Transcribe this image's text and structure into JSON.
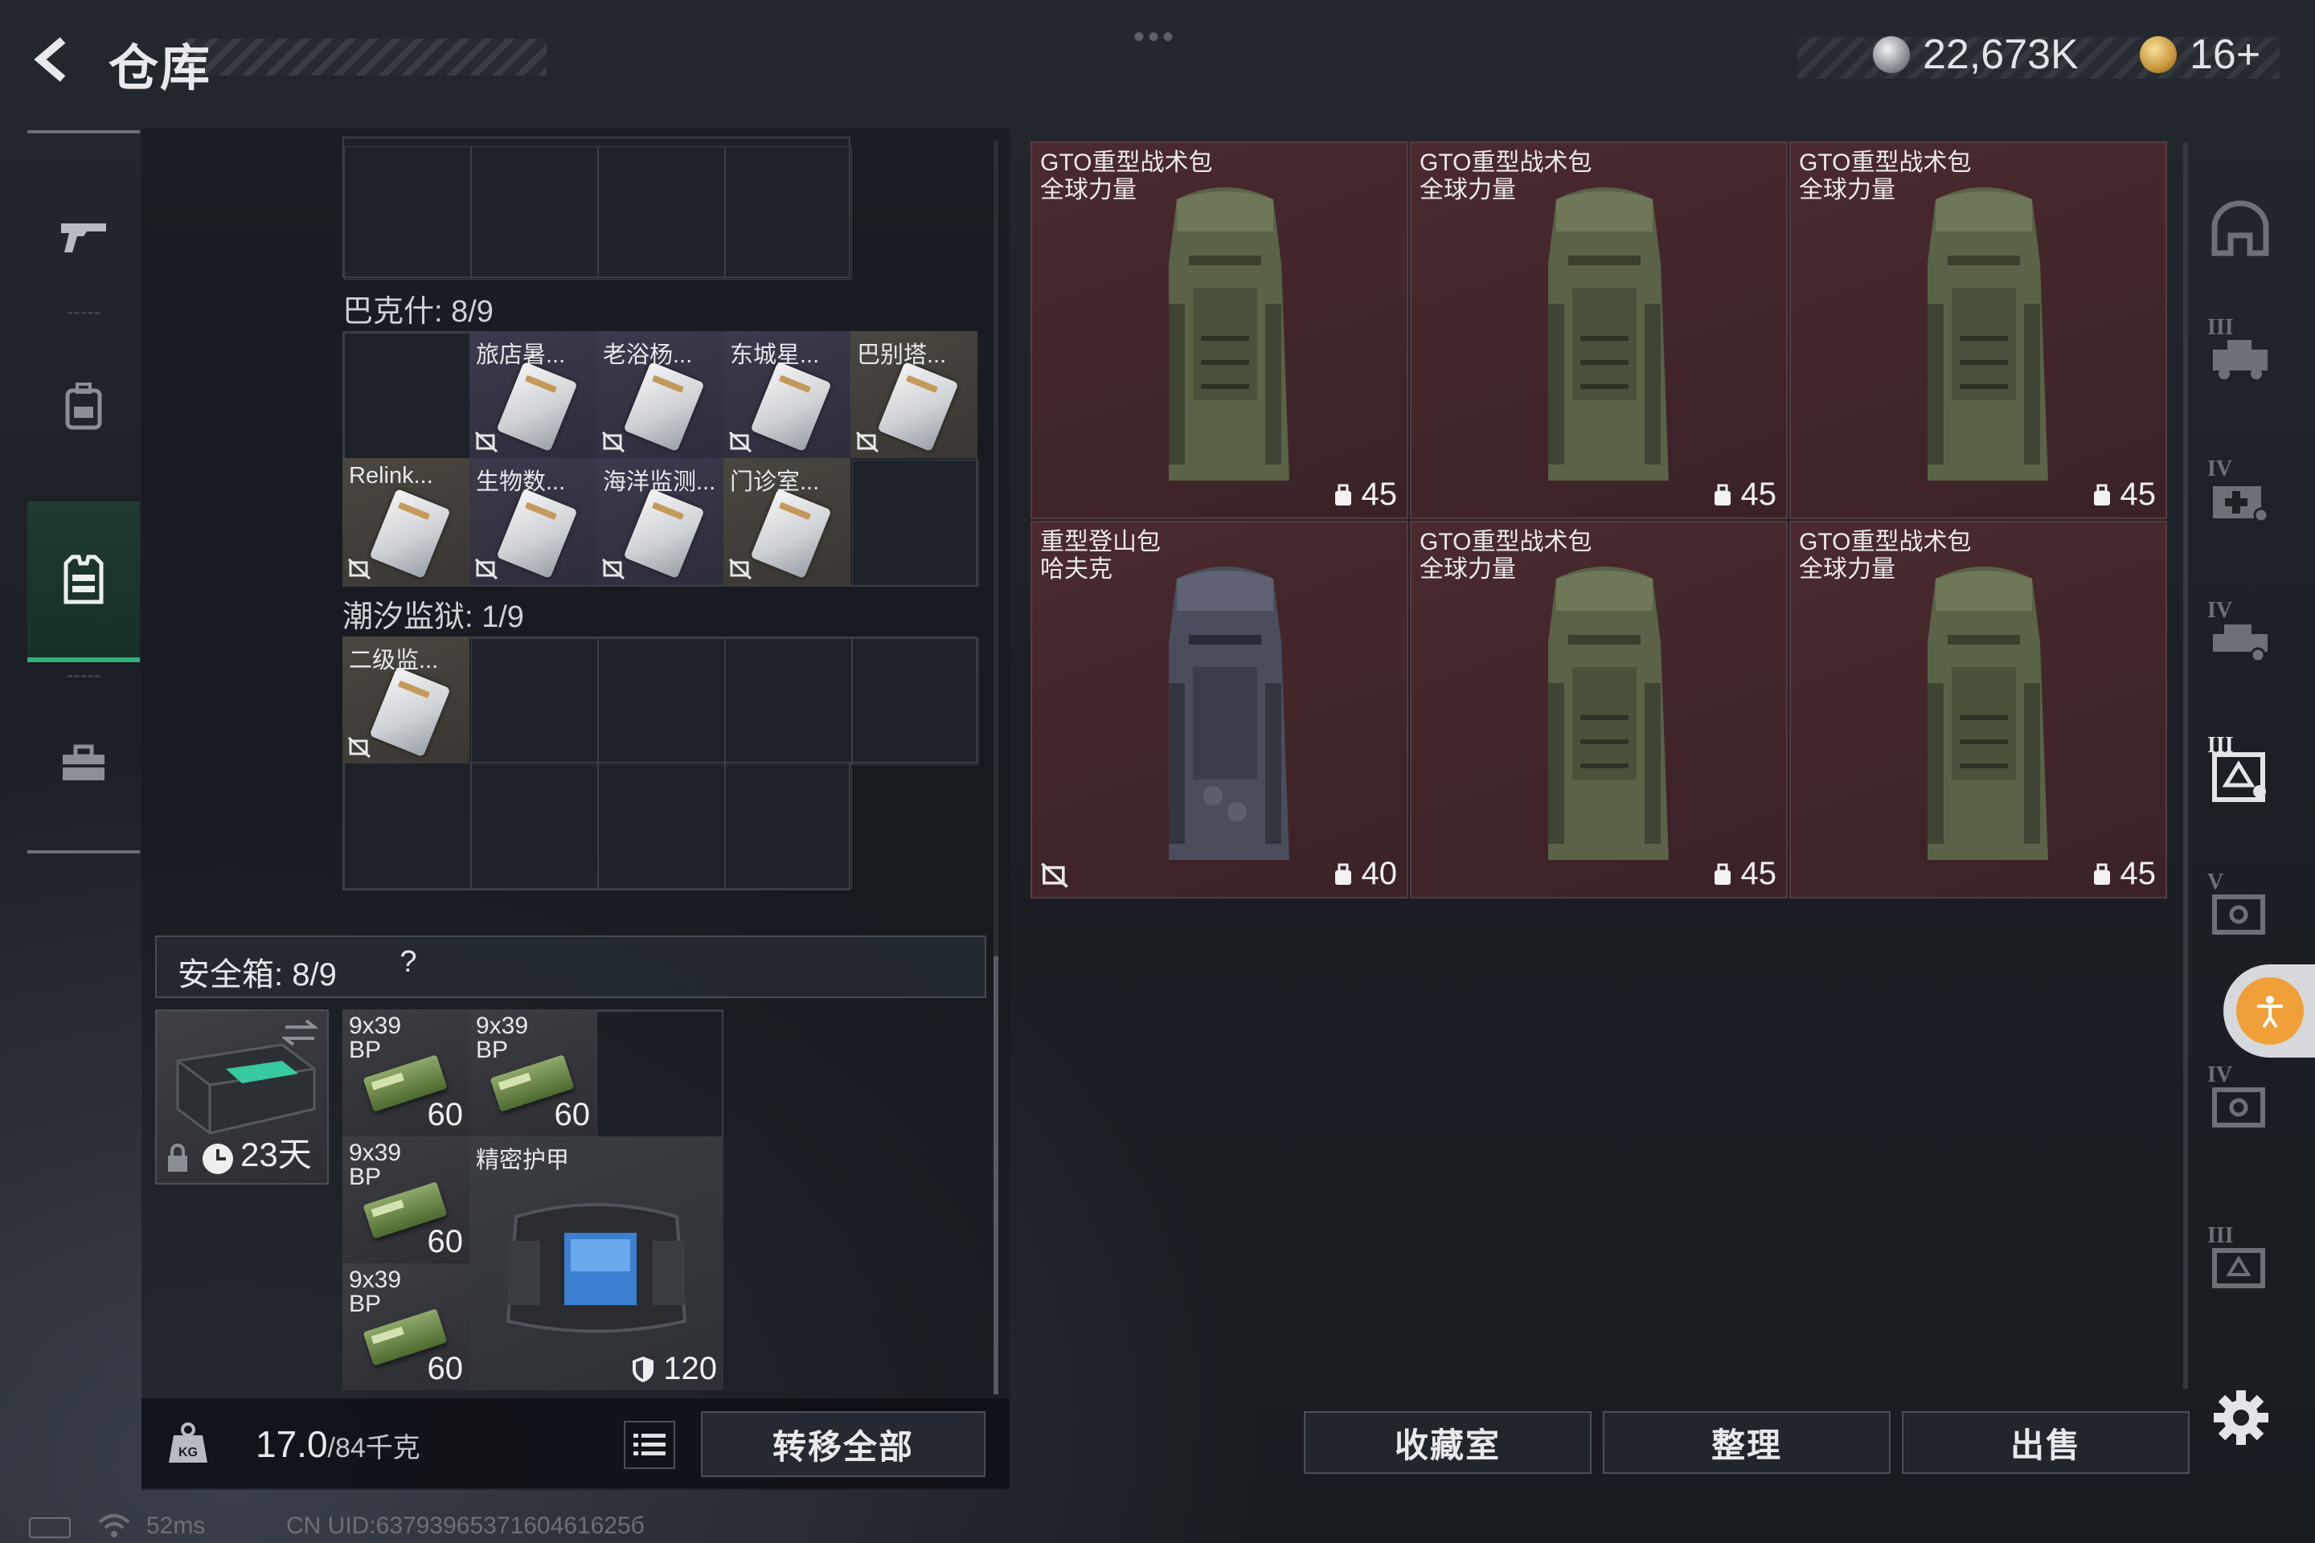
{
  "header": {
    "title": "仓库",
    "currency_silver": "22,673K",
    "currency_gold": "16+"
  },
  "left_nav": [
    "gun-icon",
    "backpack-icon",
    "vest-icon",
    "toolbox-icon"
  ],
  "sections": {
    "bakshi": {
      "label": "巴克什: 8/9",
      "items": [
        {
          "label": "旅店暑..."
        },
        {
          "label": "老浴杨..."
        },
        {
          "label": "东城星..."
        },
        {
          "label": "巴别塔..."
        },
        {
          "label": "Relink..."
        },
        {
          "label": "生物数..."
        },
        {
          "label": "海洋监测..."
        },
        {
          "label": "门诊室..."
        }
      ]
    },
    "tidal_prison": {
      "label": "潮汐监狱: 1/9",
      "items": [
        {
          "label": "二级监..."
        }
      ]
    }
  },
  "safe_box": {
    "title": "安全箱: 8/9",
    "help": "?",
    "duration": "23天",
    "ammo": [
      {
        "label_line1": "9x39",
        "label_line2": "BP",
        "count": "60"
      },
      {
        "label_line1": "9x39",
        "label_line2": "BP",
        "count": "60"
      },
      {
        "label_line1": "9x39",
        "label_line2": "BP",
        "count": "60"
      },
      {
        "label_line1": "9x39",
        "label_line2": "BP",
        "count": "60"
      }
    ],
    "armor": {
      "label": "精密护甲",
      "value": "120"
    }
  },
  "bottom_left": {
    "weight_current": "17.0",
    "weight_max": "/84千克",
    "transfer_all": "转移全部"
  },
  "stash_items": [
    {
      "line1": "GTO重型战术包",
      "line2": "全球力量",
      "capacity": "45",
      "color": "olive"
    },
    {
      "line1": "GTO重型战术包",
      "line2": "全球力量",
      "capacity": "45",
      "color": "olive"
    },
    {
      "line1": "GTO重型战术包",
      "line2": "全球力量",
      "capacity": "45",
      "color": "olive"
    },
    {
      "line1": "重型登山包",
      "line2": "哈夫克",
      "capacity": "40",
      "color": "gray"
    },
    {
      "line1": "GTO重型战术包",
      "line2": "全球力量",
      "capacity": "45",
      "color": "olive"
    },
    {
      "line1": "GTO重型战术包",
      "line2": "全球力量",
      "capacity": "45",
      "color": "olive"
    }
  ],
  "bottom_right": {
    "collection": "收藏室",
    "organize": "整理",
    "sell": "出售"
  },
  "right_nav": [
    {
      "roman": "",
      "icon": "helmet-icon"
    },
    {
      "roman": "III",
      "icon": "vehicle-icon"
    },
    {
      "roman": "IV",
      "icon": "medkit-case-icon"
    },
    {
      "roman": "IV",
      "icon": "vehicle-icon"
    },
    {
      "roman": "III",
      "icon": "safe-case-icon"
    },
    {
      "roman": "V",
      "icon": "case-icon"
    },
    {
      "roman": "IV",
      "icon": "case-icon"
    },
    {
      "roman": "III",
      "icon": "case-icon"
    }
  ],
  "status_bar": {
    "ping": "52ms",
    "uid": "CN UID:6379396537160461625б"
  },
  "colors": {
    "accent_green": "#2fb27a",
    "stash_red": "#4a2a2e",
    "access_orange": "#f0a038"
  }
}
